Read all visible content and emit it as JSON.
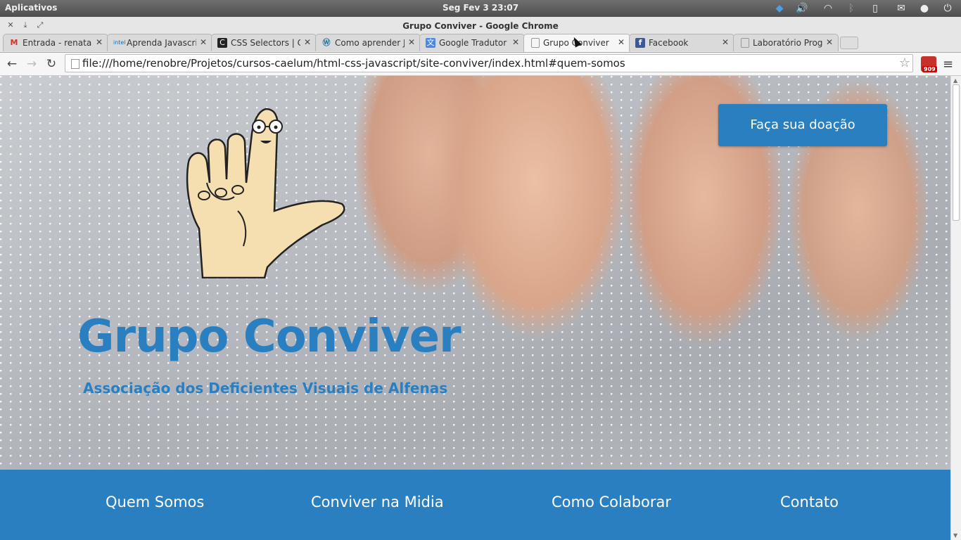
{
  "system_panel": {
    "apps_label": "Aplicativos",
    "clock": "Seg Fev  3 23:07",
    "tray_icons": [
      "dropbox-icon",
      "volume-icon",
      "wifi-icon",
      "bluetooth-icon",
      "battery-icon",
      "mail-icon",
      "user-icon",
      "power-icon"
    ]
  },
  "window": {
    "title": "Grupo Conviver - Google Chrome"
  },
  "tabs": [
    {
      "label": "Entrada - renata.v",
      "favicon": "gmail-icon"
    },
    {
      "label": "Aprenda Javascrip",
      "favicon": "intel-icon"
    },
    {
      "label": "CSS Selectors | Co",
      "favicon": "codecademy-icon"
    },
    {
      "label": "Como aprender Ja",
      "favicon": "wordpress-icon"
    },
    {
      "label": "Google Tradutor",
      "favicon": "translate-icon"
    },
    {
      "label": "Grupo Conviver",
      "favicon": "page-icon"
    },
    {
      "label": "Facebook",
      "favicon": "facebook-icon"
    },
    {
      "label": "Laboratório Progr",
      "favicon": "page-icon"
    }
  ],
  "active_tab_index": 5,
  "toolbar": {
    "url": "file:///home/renobre/Projetos/cursos-caelum/html-css-javascript/site-conviver/index.html#quem-somos",
    "extension_badge": "909"
  },
  "page": {
    "title": "Grupo Conviver",
    "subtitle": "Associação dos Deficientes Visuais de Alfenas",
    "donate_button": "Faça sua doação",
    "nav": [
      "Quem Somos",
      "Conviver na Midia",
      "Como Colaborar",
      "Contato"
    ],
    "brand_color": "#2a7fc1"
  }
}
